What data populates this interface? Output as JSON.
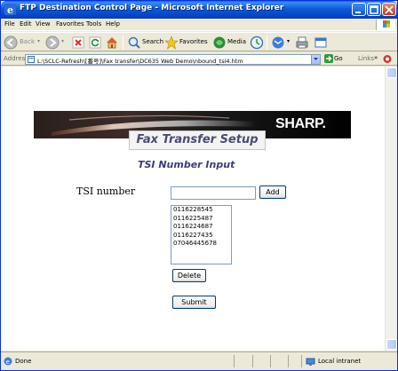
{
  "window": {
    "title": "FTP Destination Control Page - Microsoft Internet Explorer"
  },
  "menu": [
    "File",
    "Edit",
    "View",
    "Favorites",
    "Tools",
    "Help"
  ],
  "toolbar": {
    "back_label": "Back",
    "search_label": "Search",
    "favorites_label": "Favorites",
    "media_label": "Media"
  },
  "address": {
    "label": "Address",
    "url": "L:\\SCLC-Refresh\\[番号]\\Fax transfer\\DC635 Web Demo\\nbound_tsi4.htm",
    "go_label": "Go",
    "links_label": "Links"
  },
  "banner": {
    "brand": "SHARP."
  },
  "page": {
    "heading": "Fax Transfer Setup",
    "subheading": "TSI Number Input",
    "tsi_label": "TSI number",
    "tsi_input_value": "",
    "add_label": "Add",
    "tsi_numbers": [
      "0116228545",
      "0116225487",
      "0116224687",
      "0116227435",
      "07046445678"
    ],
    "delete_label": "Delete",
    "submit_label": "Submit"
  },
  "status": {
    "text": "Done",
    "zone": "Local intranet"
  },
  "colors": {
    "titlebar": "#0a5fdd",
    "heading": "#4a4a78",
    "subheading": "#3c3c7c"
  }
}
